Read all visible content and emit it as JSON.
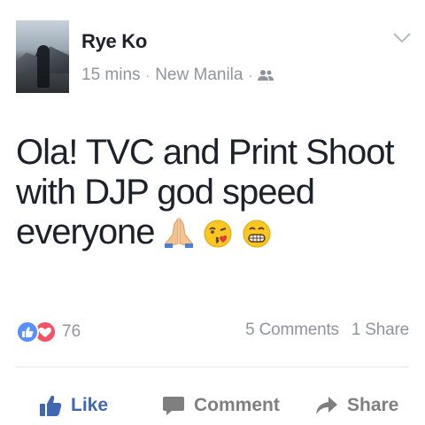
{
  "post": {
    "author": "Rye Ko",
    "time": "15 mins",
    "separator": "·",
    "location": "New Manila",
    "audience_icon": "friends-icon",
    "text": "Ola! TVC and Print Shoot with DJP god speed everyone",
    "emojis": [
      "folded-hands-icon",
      "kissing-heart-icon",
      "grimacing-icon"
    ]
  },
  "stats": {
    "reaction_icons": [
      "like-reaction-icon",
      "love-reaction-icon"
    ],
    "reaction_count": "76",
    "comments": "5 Comments",
    "shares": "1 Share"
  },
  "actions": {
    "like": "Like",
    "comment": "Comment",
    "share": "Share"
  },
  "colors": {
    "like_blue": "#4267b2",
    "love_red": "#f25268",
    "meta_gray": "#90949c",
    "text_dark": "#1d2129"
  }
}
